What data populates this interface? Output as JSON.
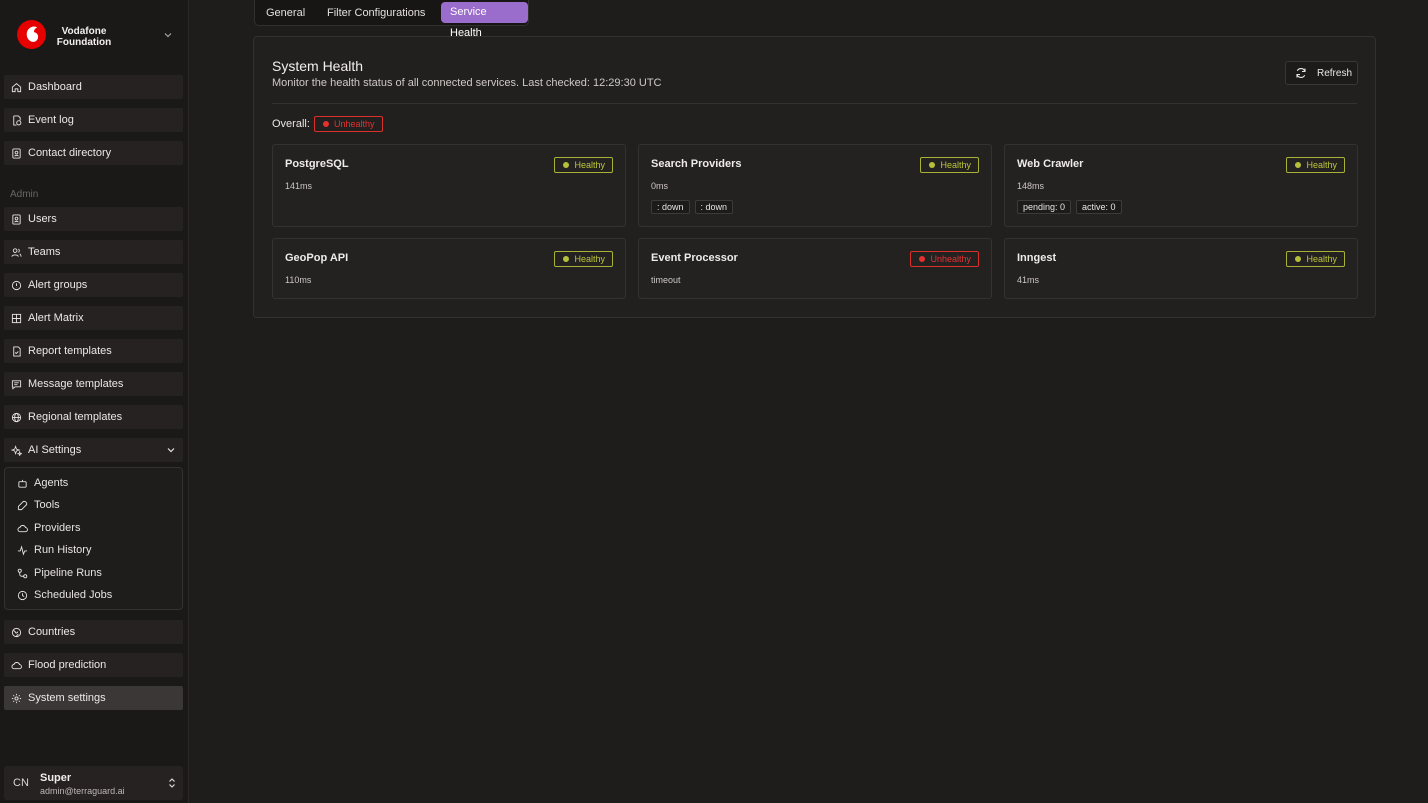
{
  "brand": {
    "name": "Vodafone Foundation"
  },
  "colors": {
    "accent": "#9a6ccb",
    "healthy": "#b5bf3a",
    "unhealthy": "#e5322f",
    "brand": "#e60000"
  },
  "nav": {
    "dashboard": "Dashboard",
    "event_log": "Event log",
    "contact_directory": "Contact directory",
    "admin_label": "Admin",
    "users": "Users",
    "teams": "Teams",
    "alert_groups": "Alert groups",
    "alert_matrix": "Alert Matrix",
    "report_templates": "Report templates",
    "message_templates": "Message templates",
    "regional_templates": "Regional templates",
    "ai_settings": "AI Settings",
    "ai_sub": {
      "agents": "Agents",
      "tools": "Tools",
      "providers": "Providers",
      "run_history": "Run History",
      "pipeline_runs": "Pipeline Runs",
      "scheduled_jobs": "Scheduled Jobs"
    },
    "countries": "Countries",
    "flood_prediction": "Flood prediction",
    "system_settings": "System settings"
  },
  "user": {
    "initials": "CN",
    "name": "Super",
    "email": "admin@terraguard.ai"
  },
  "tabs": {
    "general": "General",
    "filter_configurations": "Filter Configurations",
    "service_health": "Service Health"
  },
  "health": {
    "title": "System Health",
    "description": "Monitor the health status of all connected services. Last checked: 12:29:30 UTC",
    "refresh_label": "Refresh",
    "overall_label": "Overall:",
    "overall_status": "Unhealthy",
    "services": {
      "postgres": {
        "name": "PostgreSQL",
        "status": "Healthy",
        "meta": "141ms"
      },
      "search": {
        "name": "Search Providers",
        "status": "Healthy",
        "meta": "0ms",
        "chip1": ": down",
        "chip2": ": down"
      },
      "crawler": {
        "name": "Web Crawler",
        "status": "Healthy",
        "meta": "148ms",
        "chip1": "pending: 0",
        "chip2": "active: 0"
      },
      "geopop": {
        "name": "GeoPop API",
        "status": "Healthy",
        "meta": "110ms"
      },
      "event_processor": {
        "name": "Event Processor",
        "status": "Unhealthy",
        "meta": "timeout"
      },
      "inngest": {
        "name": "Inngest",
        "status": "Healthy",
        "meta": "41ms"
      }
    }
  }
}
